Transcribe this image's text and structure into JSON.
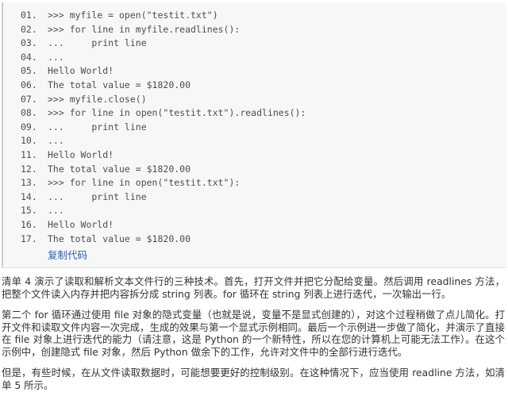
{
  "code_listing": {
    "copy_label": "复制代码",
    "lines": [
      {
        "num": "01.",
        "text": ">>> myfile = open(\"testit.txt\")"
      },
      {
        "num": "02.",
        "text": ">>> for line in myfile.readlines():"
      },
      {
        "num": "03.",
        "text": "...     print line"
      },
      {
        "num": "04.",
        "text": "..."
      },
      {
        "num": "05.",
        "text": "Hello World!"
      },
      {
        "num": "06.",
        "text": "The total value = $1820.00"
      },
      {
        "num": "07.",
        "text": ">>> myfile.close()"
      },
      {
        "num": "08.",
        "text": ">>> for line in open(\"testit.txt\").readlines():"
      },
      {
        "num": "09.",
        "text": "...     print line"
      },
      {
        "num": "10.",
        "text": "..."
      },
      {
        "num": "11.",
        "text": "Hello World!"
      },
      {
        "num": "12.",
        "text": "The total value = $1820.00"
      },
      {
        "num": "13.",
        "text": ">>> for line in open(\"testit.txt\"):"
      },
      {
        "num": "14.",
        "text": "...     print line"
      },
      {
        "num": "15.",
        "text": "..."
      },
      {
        "num": "16.",
        "text": "Hello World!"
      },
      {
        "num": "17.",
        "text": "The total value = $1820.00"
      }
    ]
  },
  "prose": {
    "paragraphs": [
      "清单 4 演示了读取和解析文本文件行的三种技术。首先，打开文件并把它分配给变量。然后调用 readlines 方法，把整个文件读入内存并把内容拆分成 string 列表。for 循环在 string 列表上进行迭代，一次输出一行。",
      "第二个 for 循环通过使用 file 对象的隐式变量（也就是说，变量不是显式创建的），对这个过程稍做了点儿简化。打开文件和读取文件内容一次完成，生成的效果与第一个显式示例相同。最后一个示例进一步做了简化，并演示了直接在 file 对象上进行迭代的能力（请注意，这是 Python 的一个新特性，所以在您的计算机上可能无法工作）。在这个示例中，创建隐式 file 对象，然后 Python 做余下的工作，允许对文件中的全部行进行迭代。",
      "但是，有些时候，在从文件读取数据时，可能想要更好的控制级别。在这种情况下，应当使用 readline 方法，如清单 5 所示。"
    ]
  },
  "colors": {
    "code_background": "#f7f7f7",
    "code_border": "#cccccc",
    "code_text": "#4d4d4d",
    "link": "#2f5fa8",
    "body_text": "#333333",
    "page_background": "#ffffff"
  }
}
